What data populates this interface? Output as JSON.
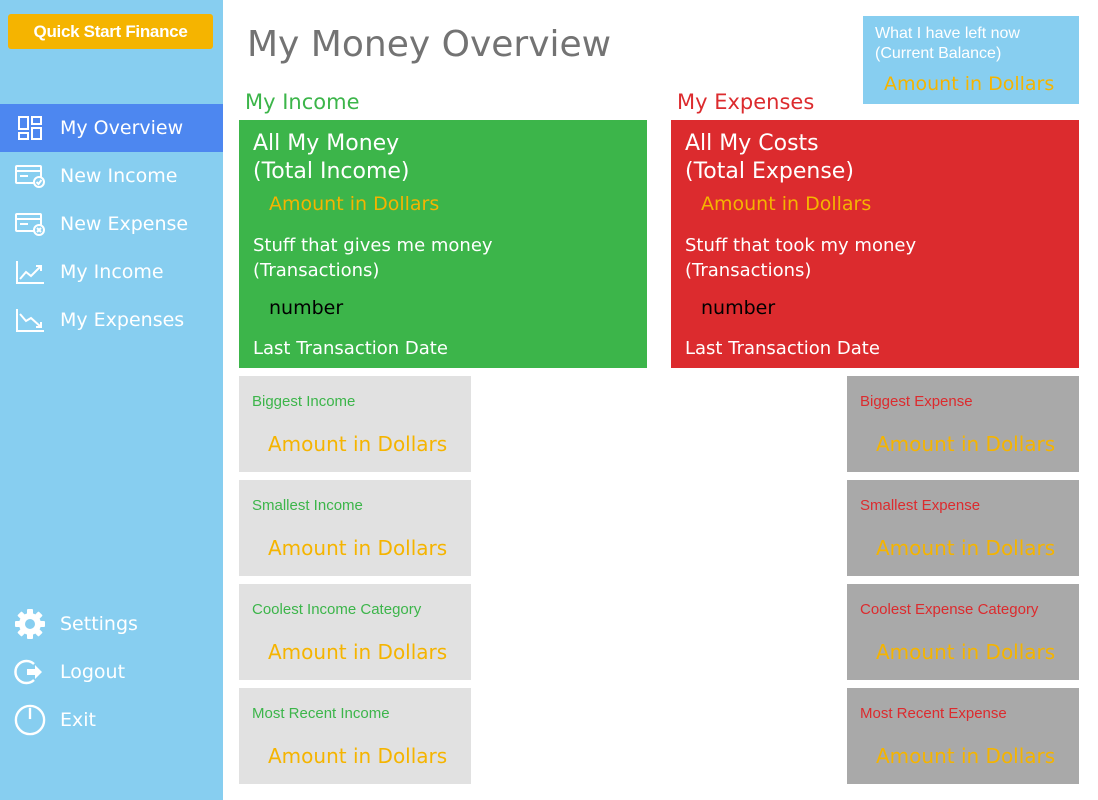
{
  "app": {
    "logo": "Quick Start Finance"
  },
  "sidebar": {
    "items": [
      {
        "label": "My Overview",
        "icon": "dashboard-icon"
      },
      {
        "label": "New Income",
        "icon": "card-add-icon"
      },
      {
        "label": "New Expense",
        "icon": "card-remove-icon"
      },
      {
        "label": "My Income",
        "icon": "trend-up-icon"
      },
      {
        "label": "My Expenses",
        "icon": "trend-down-icon"
      }
    ],
    "bottom": [
      {
        "label": "Settings",
        "icon": "gear-icon"
      },
      {
        "label": "Logout",
        "icon": "logout-icon"
      },
      {
        "label": "Exit",
        "icon": "power-icon"
      }
    ]
  },
  "main": {
    "title": "My Money Overview",
    "balance": {
      "label": "What I have left now (Current Balance)",
      "amount": "Amount in Dollars"
    },
    "income": {
      "section_label": "My Income",
      "summary": {
        "heading_line1": "All My Money",
        "heading_line2": "(Total Income)",
        "amount": "Amount in Dollars",
        "sub_line1": "Stuff that gives me money",
        "sub_line2": "(Transactions)",
        "number": "number",
        "date": "Last Transaction Date"
      },
      "cards": [
        {
          "label": "Biggest Income",
          "amount": "Amount in Dollars"
        },
        {
          "label": "Smallest Income",
          "amount": "Amount in Dollars"
        },
        {
          "label": "Coolest Income Category",
          "amount": "Amount in Dollars"
        },
        {
          "label": "Most Recent Income",
          "amount": "Amount in Dollars"
        }
      ]
    },
    "expenses": {
      "section_label": "My Expenses",
      "summary": {
        "heading_line1": "All My Costs",
        "heading_line2": "(Total Expense)",
        "amount": "Amount in Dollars",
        "sub_line1": "Stuff that took my money",
        "sub_line2": "(Transactions)",
        "number": "number",
        "date": "Last Transaction Date"
      },
      "cards": [
        {
          "label": "Biggest Expense",
          "amount": "Amount in Dollars"
        },
        {
          "label": "Smallest Expense",
          "amount": "Amount in Dollars"
        },
        {
          "label": "Coolest Expense Category",
          "amount": "Amount in Dollars"
        },
        {
          "label": "Most Recent Expense",
          "amount": "Amount in Dollars"
        }
      ]
    }
  },
  "colors": {
    "sidebar": "#87cef0",
    "active": "#4d87f0",
    "accent": "#f5b400",
    "income": "#3cb54a",
    "expense": "#dc2b2e",
    "income_card": "#e1e1e1",
    "expense_card": "#a9a9a9"
  }
}
